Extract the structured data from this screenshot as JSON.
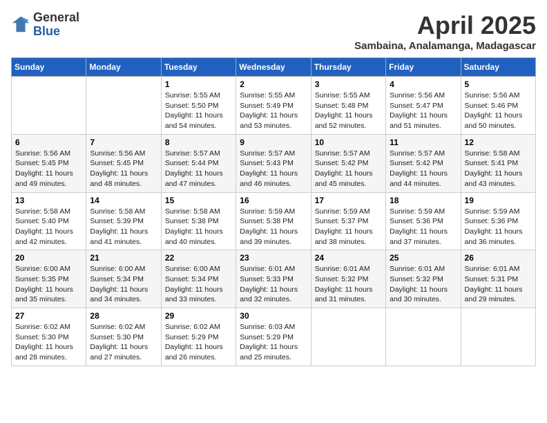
{
  "logo": {
    "general": "General",
    "blue": "Blue"
  },
  "header": {
    "month": "April 2025",
    "location": "Sambaina, Analamanga, Madagascar"
  },
  "weekdays": [
    "Sunday",
    "Monday",
    "Tuesday",
    "Wednesday",
    "Thursday",
    "Friday",
    "Saturday"
  ],
  "weeks": [
    [
      {
        "day": "",
        "sunrise": "",
        "sunset": "",
        "daylight": ""
      },
      {
        "day": "",
        "sunrise": "",
        "sunset": "",
        "daylight": ""
      },
      {
        "day": "1",
        "sunrise": "Sunrise: 5:55 AM",
        "sunset": "Sunset: 5:50 PM",
        "daylight": "Daylight: 11 hours and 54 minutes."
      },
      {
        "day": "2",
        "sunrise": "Sunrise: 5:55 AM",
        "sunset": "Sunset: 5:49 PM",
        "daylight": "Daylight: 11 hours and 53 minutes."
      },
      {
        "day": "3",
        "sunrise": "Sunrise: 5:55 AM",
        "sunset": "Sunset: 5:48 PM",
        "daylight": "Daylight: 11 hours and 52 minutes."
      },
      {
        "day": "4",
        "sunrise": "Sunrise: 5:56 AM",
        "sunset": "Sunset: 5:47 PM",
        "daylight": "Daylight: 11 hours and 51 minutes."
      },
      {
        "day": "5",
        "sunrise": "Sunrise: 5:56 AM",
        "sunset": "Sunset: 5:46 PM",
        "daylight": "Daylight: 11 hours and 50 minutes."
      }
    ],
    [
      {
        "day": "6",
        "sunrise": "Sunrise: 5:56 AM",
        "sunset": "Sunset: 5:45 PM",
        "daylight": "Daylight: 11 hours and 49 minutes."
      },
      {
        "day": "7",
        "sunrise": "Sunrise: 5:56 AM",
        "sunset": "Sunset: 5:45 PM",
        "daylight": "Daylight: 11 hours and 48 minutes."
      },
      {
        "day": "8",
        "sunrise": "Sunrise: 5:57 AM",
        "sunset": "Sunset: 5:44 PM",
        "daylight": "Daylight: 11 hours and 47 minutes."
      },
      {
        "day": "9",
        "sunrise": "Sunrise: 5:57 AM",
        "sunset": "Sunset: 5:43 PM",
        "daylight": "Daylight: 11 hours and 46 minutes."
      },
      {
        "day": "10",
        "sunrise": "Sunrise: 5:57 AM",
        "sunset": "Sunset: 5:42 PM",
        "daylight": "Daylight: 11 hours and 45 minutes."
      },
      {
        "day": "11",
        "sunrise": "Sunrise: 5:57 AM",
        "sunset": "Sunset: 5:42 PM",
        "daylight": "Daylight: 11 hours and 44 minutes."
      },
      {
        "day": "12",
        "sunrise": "Sunrise: 5:58 AM",
        "sunset": "Sunset: 5:41 PM",
        "daylight": "Daylight: 11 hours and 43 minutes."
      }
    ],
    [
      {
        "day": "13",
        "sunrise": "Sunrise: 5:58 AM",
        "sunset": "Sunset: 5:40 PM",
        "daylight": "Daylight: 11 hours and 42 minutes."
      },
      {
        "day": "14",
        "sunrise": "Sunrise: 5:58 AM",
        "sunset": "Sunset: 5:39 PM",
        "daylight": "Daylight: 11 hours and 41 minutes."
      },
      {
        "day": "15",
        "sunrise": "Sunrise: 5:58 AM",
        "sunset": "Sunset: 5:38 PM",
        "daylight": "Daylight: 11 hours and 40 minutes."
      },
      {
        "day": "16",
        "sunrise": "Sunrise: 5:59 AM",
        "sunset": "Sunset: 5:38 PM",
        "daylight": "Daylight: 11 hours and 39 minutes."
      },
      {
        "day": "17",
        "sunrise": "Sunrise: 5:59 AM",
        "sunset": "Sunset: 5:37 PM",
        "daylight": "Daylight: 11 hours and 38 minutes."
      },
      {
        "day": "18",
        "sunrise": "Sunrise: 5:59 AM",
        "sunset": "Sunset: 5:36 PM",
        "daylight": "Daylight: 11 hours and 37 minutes."
      },
      {
        "day": "19",
        "sunrise": "Sunrise: 5:59 AM",
        "sunset": "Sunset: 5:36 PM",
        "daylight": "Daylight: 11 hours and 36 minutes."
      }
    ],
    [
      {
        "day": "20",
        "sunrise": "Sunrise: 6:00 AM",
        "sunset": "Sunset: 5:35 PM",
        "daylight": "Daylight: 11 hours and 35 minutes."
      },
      {
        "day": "21",
        "sunrise": "Sunrise: 6:00 AM",
        "sunset": "Sunset: 5:34 PM",
        "daylight": "Daylight: 11 hours and 34 minutes."
      },
      {
        "day": "22",
        "sunrise": "Sunrise: 6:00 AM",
        "sunset": "Sunset: 5:34 PM",
        "daylight": "Daylight: 11 hours and 33 minutes."
      },
      {
        "day": "23",
        "sunrise": "Sunrise: 6:01 AM",
        "sunset": "Sunset: 5:33 PM",
        "daylight": "Daylight: 11 hours and 32 minutes."
      },
      {
        "day": "24",
        "sunrise": "Sunrise: 6:01 AM",
        "sunset": "Sunset: 5:32 PM",
        "daylight": "Daylight: 11 hours and 31 minutes."
      },
      {
        "day": "25",
        "sunrise": "Sunrise: 6:01 AM",
        "sunset": "Sunset: 5:32 PM",
        "daylight": "Daylight: 11 hours and 30 minutes."
      },
      {
        "day": "26",
        "sunrise": "Sunrise: 6:01 AM",
        "sunset": "Sunset: 5:31 PM",
        "daylight": "Daylight: 11 hours and 29 minutes."
      }
    ],
    [
      {
        "day": "27",
        "sunrise": "Sunrise: 6:02 AM",
        "sunset": "Sunset: 5:30 PM",
        "daylight": "Daylight: 11 hours and 28 minutes."
      },
      {
        "day": "28",
        "sunrise": "Sunrise: 6:02 AM",
        "sunset": "Sunset: 5:30 PM",
        "daylight": "Daylight: 11 hours and 27 minutes."
      },
      {
        "day": "29",
        "sunrise": "Sunrise: 6:02 AM",
        "sunset": "Sunset: 5:29 PM",
        "daylight": "Daylight: 11 hours and 26 minutes."
      },
      {
        "day": "30",
        "sunrise": "Sunrise: 6:03 AM",
        "sunset": "Sunset: 5:29 PM",
        "daylight": "Daylight: 11 hours and 25 minutes."
      },
      {
        "day": "",
        "sunrise": "",
        "sunset": "",
        "daylight": ""
      },
      {
        "day": "",
        "sunrise": "",
        "sunset": "",
        "daylight": ""
      },
      {
        "day": "",
        "sunrise": "",
        "sunset": "",
        "daylight": ""
      }
    ]
  ]
}
